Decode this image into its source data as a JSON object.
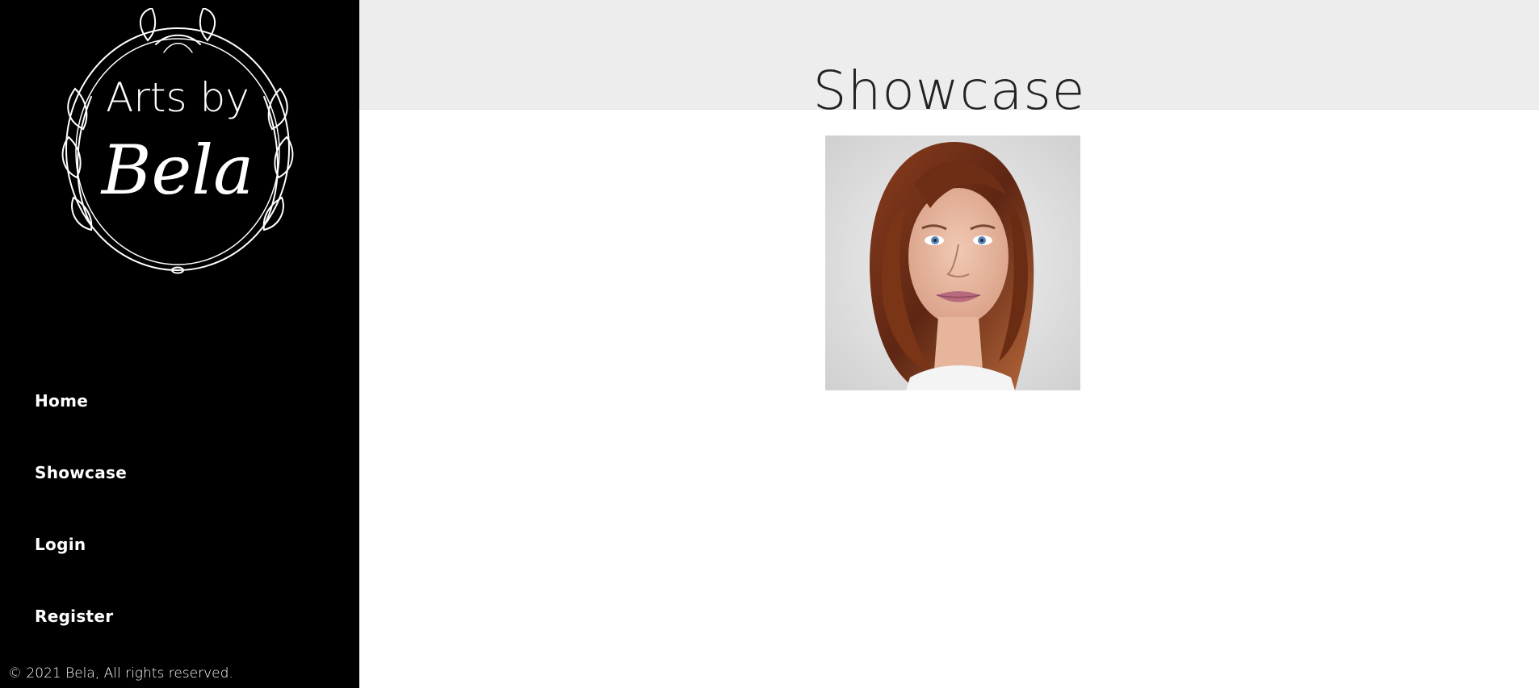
{
  "logo": {
    "line1": "Arts by",
    "line2": "Bela"
  },
  "nav": {
    "items": [
      {
        "label": "Home"
      },
      {
        "label": "Showcase"
      },
      {
        "label": "Login"
      },
      {
        "label": "Register"
      }
    ]
  },
  "footer": {
    "copyright": "© 2021 Bela, All rights reserved."
  },
  "header": {
    "title": "Showcase"
  },
  "colors": {
    "sidebar_bg": "#000000",
    "header_bg": "#ededed",
    "text_light": "#ffffff",
    "text_dark": "#222222"
  },
  "gallery": {
    "items": [
      {
        "icon": "portrait-painting-image"
      }
    ]
  }
}
